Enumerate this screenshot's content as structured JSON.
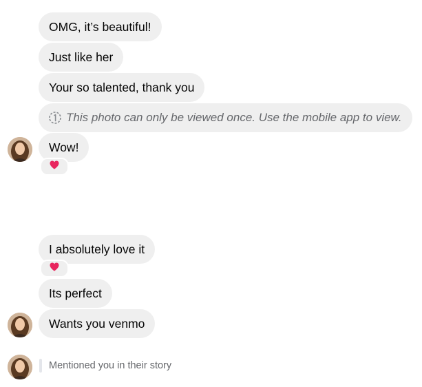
{
  "messages": {
    "m1": "OMG, it’s beautiful!",
    "m2": "Just like her",
    "m3": "Your so talented, thank you",
    "m4": "This photo can only be viewed once. Use the mobile app to view.",
    "m5": "Wow!",
    "m6": "I absolutely love it",
    "m7": "Its perfect",
    "m8": "Wants you venmo"
  },
  "reactions": {
    "r1": "heart-icon",
    "r2": "heart-icon"
  },
  "story": {
    "text": "Mentioned you in their story"
  },
  "colors": {
    "bubble_bg": "#efefef",
    "secondary_text": "#65676b",
    "heart": "#e8265e"
  }
}
